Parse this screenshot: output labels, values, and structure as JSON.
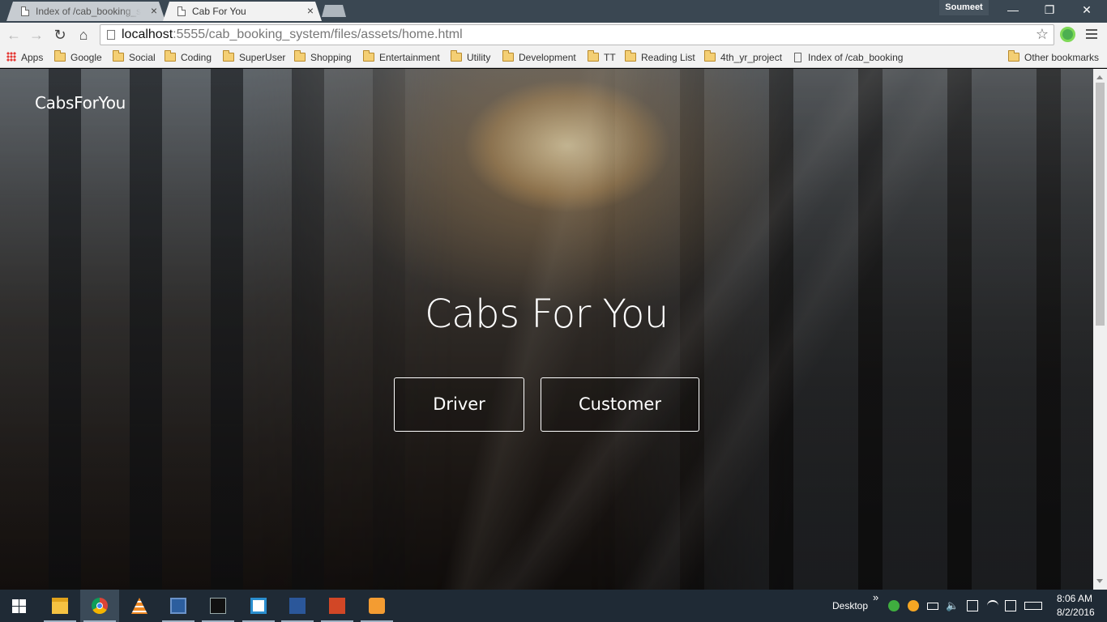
{
  "browser": {
    "tabs": [
      {
        "title": "Index of /cab_booking_sys",
        "active": false,
        "close": "×"
      },
      {
        "title": "Cab For You",
        "active": true,
        "close": "×"
      }
    ],
    "profile_name": "Soumeet",
    "window_controls": {
      "minimize": "—",
      "restore": "❐",
      "close": "✕"
    },
    "address_bar": {
      "host": "localhost",
      "path": ":5555/cab_booking_system/files/assets/home.html"
    },
    "bookmarks": [
      {
        "label": "Apps",
        "icon": "apps-grid-icon"
      },
      {
        "label": "Google",
        "icon": "folder-icon"
      },
      {
        "label": "Social",
        "icon": "folder-icon"
      },
      {
        "label": "Coding",
        "icon": "folder-icon"
      },
      {
        "label": "SuperUser",
        "icon": "folder-icon"
      },
      {
        "label": "Shopping",
        "icon": "folder-icon"
      },
      {
        "label": "Entertainment",
        "icon": "folder-icon"
      },
      {
        "label": "Utility",
        "icon": "folder-icon"
      },
      {
        "label": "Development",
        "icon": "folder-icon"
      },
      {
        "label": "TT",
        "icon": "folder-icon"
      },
      {
        "label": "Reading List",
        "icon": "folder-icon"
      },
      {
        "label": "4th_yr_project",
        "icon": "folder-icon"
      },
      {
        "label": "Index of /cab_booking",
        "icon": "page-icon"
      },
      {
        "label": "Other bookmarks",
        "icon": "folder-icon"
      }
    ]
  },
  "page": {
    "brand": "CabsForYou",
    "hero_title": "Cabs For You",
    "buttons": {
      "driver": "Driver",
      "customer": "Customer"
    }
  },
  "taskbar": {
    "apps": [
      {
        "name": "file-explorer-icon",
        "color": "#f5c242",
        "running": true,
        "active": false
      },
      {
        "name": "chrome-icon",
        "color": "#4285f4",
        "running": true,
        "active": true
      },
      {
        "name": "vlc-icon",
        "color": "#f08a24",
        "running": false,
        "active": false
      },
      {
        "name": "virtualbox-icon",
        "color": "#2c5e9e",
        "running": true,
        "active": false
      },
      {
        "name": "command-prompt-icon",
        "color": "#111111",
        "running": true,
        "active": false
      },
      {
        "name": "brackets-icon",
        "color": "#2a8ecf",
        "running": true,
        "active": false
      },
      {
        "name": "word-icon",
        "color": "#2b579a",
        "running": true,
        "active": false
      },
      {
        "name": "powerpoint-icon",
        "color": "#d24726",
        "running": true,
        "active": false
      },
      {
        "name": "media-player-icon",
        "color": "#f39c32",
        "running": true,
        "active": false
      }
    ],
    "desktop_label": "Desktop",
    "chevron": "»",
    "time": "8:06 AM",
    "date": "8/2/2016"
  }
}
